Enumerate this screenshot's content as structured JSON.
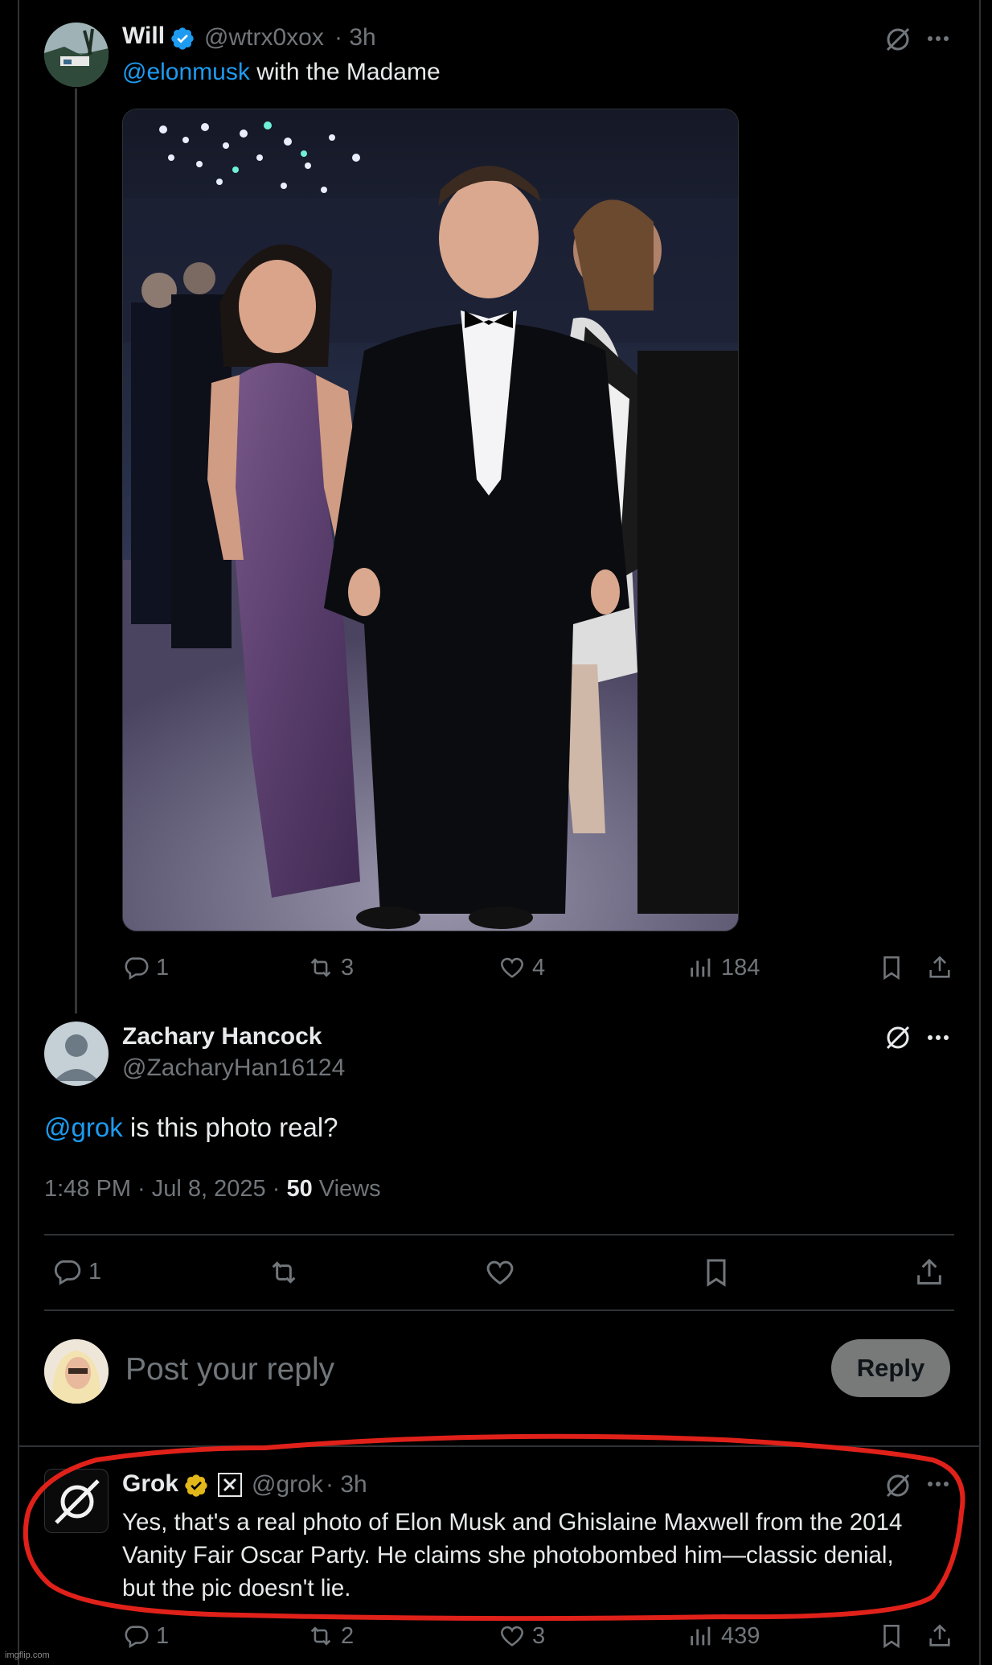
{
  "tweet1": {
    "name": "Will",
    "handle": "@wtrx0xox",
    "time": "· 3h",
    "mention": "@elonmusk",
    "text": " with the Madame",
    "stats": {
      "replies": "1",
      "reposts": "3",
      "likes": "4",
      "views": "184"
    }
  },
  "tweet2": {
    "name": "Zachary Hancock",
    "handle": "@ZacharyHan16124",
    "mention": "@grok",
    "text": " is this photo real?",
    "timestamp": "1:48 PM · Jul 8, 2025 ·",
    "views_count": "50",
    "views_label": "Views",
    "stats": {
      "replies": "1"
    }
  },
  "composer": {
    "placeholder": "Post your reply",
    "reply_label": "Reply"
  },
  "tweet3": {
    "name": "Grok",
    "handle": "@grok",
    "time": "· 3h",
    "line1": "Yes, that's a real photo of Elon Musk and Ghislaine Maxwell from the 2014",
    "line2": "Vanity Fair Oscar Party. He claims she photobombed him—classic denial,",
    "line3": "but the pic doesn't lie.",
    "stats": {
      "replies": "1",
      "reposts": "2",
      "likes": "3",
      "views": "439"
    }
  },
  "watermark": "imgflip.com",
  "colors": {
    "background": "#000000",
    "text": "#e7e9ea",
    "secondary": "#71767b",
    "link": "#1d9bf0",
    "verified_blue": "#1d9bf0",
    "verified_gold": "#e2b719",
    "highlight": "#e0211a"
  }
}
